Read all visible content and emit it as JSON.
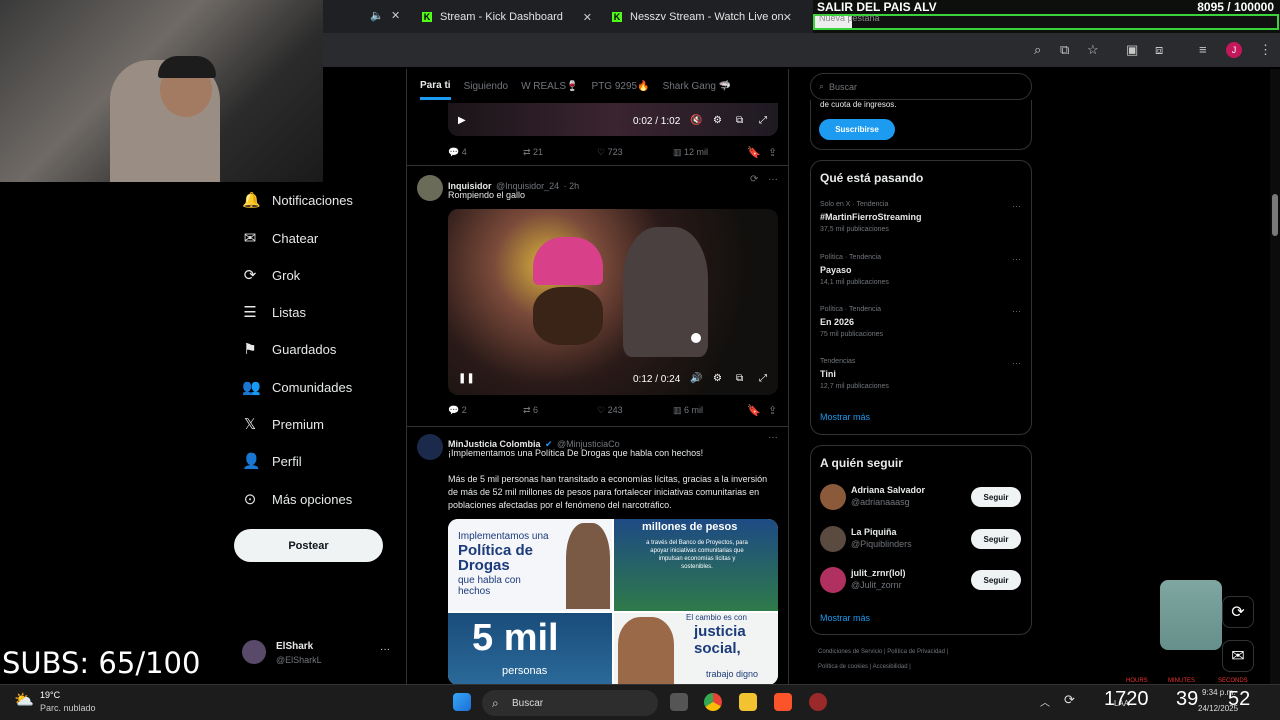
{
  "browser": {
    "tabs": [
      {
        "label": "Stream - Kick Dashboard",
        "icon": "kick-icon"
      },
      {
        "label": "Nesszv Stream - Watch Live on",
        "icon": "kick-icon"
      },
      {
        "label": "Nueva pestaña",
        "icon": "chrome-icon"
      }
    ],
    "avatar_letter": "J"
  },
  "overlay": {
    "goal_title": "SALIR DEL PAIS ALV",
    "goal_count": "8095 / 100000",
    "goal_progress": 0.081,
    "subs": "SUBS: 65/100",
    "timer_labels": [
      "HOURS",
      "MINUTES",
      "SECONDS"
    ],
    "timer_values": [
      "1720",
      "39",
      "52"
    ]
  },
  "sidebar": {
    "items": [
      {
        "label": "Notificaciones",
        "icon": "bell-icon"
      },
      {
        "label": "Chatear",
        "icon": "mail-icon"
      },
      {
        "label": "Grok",
        "icon": "grok-icon"
      },
      {
        "label": "Listas",
        "icon": "list-icon"
      },
      {
        "label": "Guardados",
        "icon": "bookmark-icon"
      },
      {
        "label": "Comunidades",
        "icon": "people-icon"
      },
      {
        "label": "Premium",
        "icon": "x-logo-icon"
      },
      {
        "label": "Perfil",
        "icon": "person-icon"
      },
      {
        "label": "Más opciones",
        "icon": "more-circle-icon"
      }
    ],
    "post_button": "Postear",
    "account": {
      "name": "ElShark",
      "handle": "@ElSharkL"
    }
  },
  "feed": {
    "tabs": [
      "Para ti",
      "Siguiendo",
      "W REALS🍷",
      "PTG 9295🔥",
      "Shark Gang 🦈"
    ],
    "post1": {
      "video_time": "0:02 / 1:02",
      "replies": "4",
      "reposts": "21",
      "likes": "723",
      "views": "12 mil"
    },
    "post2": {
      "name": "Inquisidor",
      "handle": "@Inquisidor_24",
      "time": "· 2h",
      "text": "Rompiendo el gallo",
      "video_time": "0:12 / 0:24",
      "replies": "2",
      "reposts": "6",
      "likes": "243",
      "views": "6 mil"
    },
    "post3": {
      "name": "MinJusticia Colombia",
      "handle": "@MinjusticiaCo",
      "text1": "¡Implementamos una Política De Drogas que habla con hechos!",
      "text2": "Más de 5 mil personas han transitado a economías lícitas, gracias a la inversión de más de 52 mil millones de pesos para fortalecer iniciativas comunitarias en poblaciones afectadas por el fenómeno del narcotráfico.",
      "img_a1": "Implementamos una",
      "img_a2": "Política de Drogas",
      "img_a3": "que habla con hechos",
      "img_b1": "millones de pesos",
      "img_b2": "a través del Banco de Proyectos, para apoyar iniciativas comunitarias que impulsan economías lícitas y sostenibles.",
      "img_c1": "5 mil",
      "img_c2": "personas",
      "img_d1": "El cambio es con",
      "img_d2": "justicia social,",
      "img_d3": "trabajo digno"
    }
  },
  "right": {
    "search_placeholder": "Buscar",
    "premium_text": "de cuota de ingresos.",
    "subscribe": "Suscribirse",
    "trends_title": "Qué está pasando",
    "trends": [
      {
        "meta": "Solo en X · Tendencia",
        "name": "#MartinFierroStreaming",
        "count": "37,5 mil publicaciones"
      },
      {
        "meta": "Política · Tendencia",
        "name": "Payaso",
        "count": "14,1 mil publicaciones"
      },
      {
        "meta": "Política · Tendencia",
        "name": "En 2026",
        "count": "75 mil publicaciones"
      },
      {
        "meta": "Tendencias",
        "name": "Tini",
        "count": "12,7 mil publicaciones"
      }
    ],
    "show_more": "Mostrar más",
    "follow_title": "A quién seguir",
    "follow": [
      {
        "name": "Adriana Salvador",
        "handle": "@adrianaaasg"
      },
      {
        "name": "La Piquiña",
        "handle": "@Piquiblinders"
      },
      {
        "name": "julit_zrnr(lol)",
        "handle": "@Julit_zornr"
      }
    ],
    "follow_button": "Seguir",
    "footer1": "Condiciones de Servicio | Política de Privacidad |",
    "footer2": "Política de cookies | Accesibilidad |"
  },
  "taskbar": {
    "weather_temp": "19°C",
    "weather_desc": "Parc. nublado",
    "search": "Buscar",
    "time": "9:34 p.m.",
    "date": "24/12/2025",
    "lang": "LAA"
  }
}
